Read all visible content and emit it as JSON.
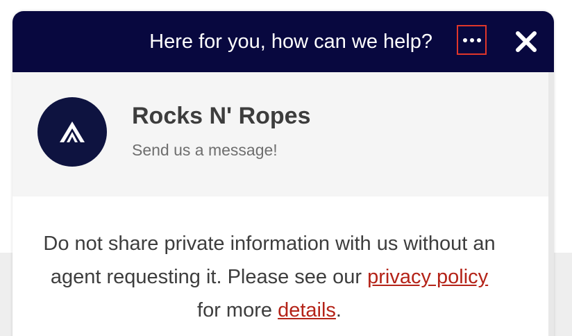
{
  "header": {
    "title": "Here for you, how can we help?",
    "menu_icon": "more-horizontal-icon",
    "close_icon": "close-icon"
  },
  "profile": {
    "name": "Rocks N' Ropes",
    "subtitle": "Send us a message!",
    "avatar_icon": "mountain-logo-icon"
  },
  "notice": {
    "line_part1": "Do not share private information with us without an agent requesting it. Please see our",
    "privacy_link": "privacy policy",
    "line_part2": "for more",
    "details_link": "details",
    "line_end": "."
  },
  "colors": {
    "header_bg": "#08083f",
    "link": "#b42318",
    "highlight_border": "#e0362a",
    "avatar_bg": "#0e1340"
  }
}
